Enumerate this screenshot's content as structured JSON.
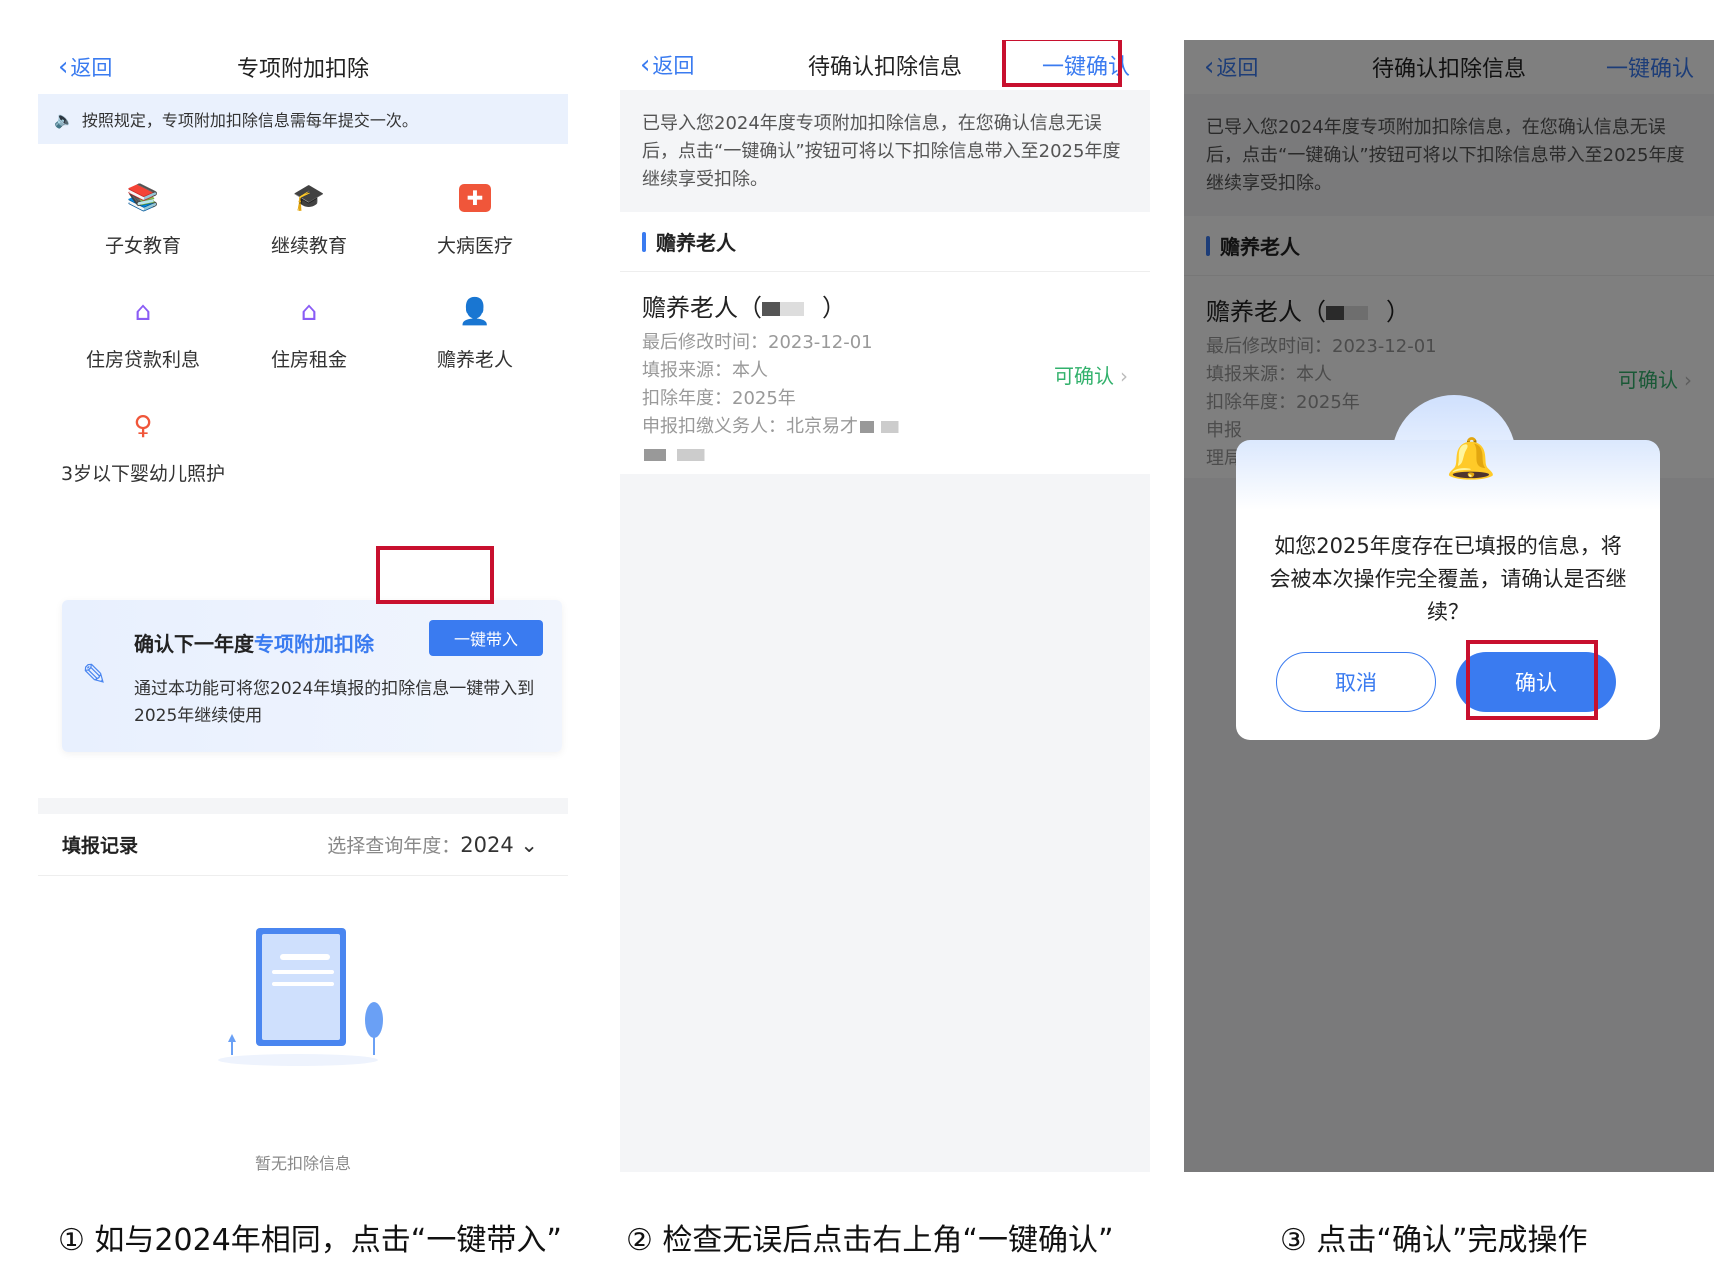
{
  "screen1": {
    "back_label": "返回",
    "title": "专项附加扣除",
    "notice": "按照规定，专项附加扣除信息需每年提交一次。",
    "categories": [
      {
        "label": "子女教育",
        "icon": "books-icon",
        "color": "#3a7bf0"
      },
      {
        "label": "继续教育",
        "icon": "graduation-cap-icon",
        "color": "#3a7bf0"
      },
      {
        "label": "大病医疗",
        "icon": "medical-kit-icon",
        "color": "#f0563a"
      },
      {
        "label": "住房贷款利息",
        "icon": "house-yen-icon",
        "color": "#8a5cf5"
      },
      {
        "label": "住房租金",
        "icon": "house-key-icon",
        "color": "#8a5cf5"
      },
      {
        "label": "赡养老人",
        "icon": "elder-icon",
        "color": "#f0a23a"
      },
      {
        "label": "3岁以下婴幼儿照护",
        "icon": "infant-icon",
        "color": "#f0563a"
      }
    ],
    "card_title_prefix": "确认下一年度",
    "card_title_highlight": "专项附加扣除",
    "card_button": "一键带入",
    "card_desc": "通过本功能可将您2024年填报的扣除信息一键带入到2025年继续使用",
    "records_heading": "填报记录",
    "year_select_label": "选择查询年度：",
    "year_select_value": "2024",
    "empty_text": "暂无扣除信息"
  },
  "screen2": {
    "back_label": "返回",
    "title": "待确认扣除信息",
    "action": "一键确认",
    "intro": "已导入您2024年度专项附加扣除信息，在您确认信息无误后，点击“一键确认”按钮可将以下扣除信息带入至2025年度继续享受扣除。",
    "section": "赡养老人",
    "item_name": "赡养老人（",
    "item_name_close": "）",
    "modified": "最后修改时间：2023-12-01",
    "source": "填报来源：本人",
    "year": "扣除年度：2025年",
    "withholder": "申报扣缴义务人：北京易才",
    "status": "可确认"
  },
  "screen3": {
    "back_label": "返回",
    "title": "待确认扣除信息",
    "action": "一键确认",
    "intro": "已导入您2024年度专项附加扣除信息，在您确认信息无误后，点击“一键确认”按钮可将以下扣除信息带入至2025年度继续享受扣除。",
    "section": "赡养老人",
    "item_name": "赡养老人（",
    "item_name_close": "）",
    "modified": "最后修改时间：2023-12-01",
    "source": "填报来源：本人",
    "year": "扣除年度：2025年",
    "withholder_partial": "申报",
    "extra_partial": "理局",
    "status": "可确认",
    "dialog_message": "如您2025年度存在已填报的信息，将会被本次操作完全覆盖，请确认是否继续？",
    "cancel": "取消",
    "confirm": "确认"
  },
  "captions": [
    "① 如与2024年相同，点击“一键带入”",
    "② 检查无误后点击右上角“一键确认”",
    "③ 点击“确认”完成操作"
  ]
}
